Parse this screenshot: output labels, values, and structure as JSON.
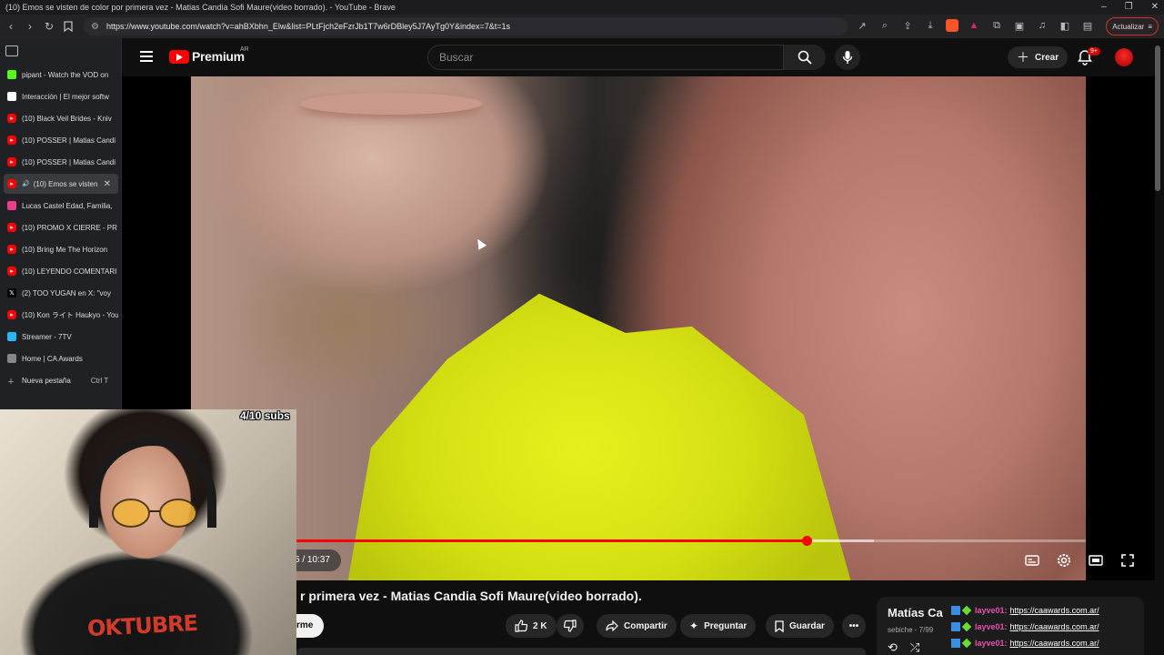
{
  "window": {
    "title": "(10) Emos se visten de color por primera vez - Matias Candia Sofi Maure(video borrado). - YouTube - Brave"
  },
  "browser": {
    "url": "https://www.youtube.com/watch?v=ahBXbhn_Elw&list=PLtFjch2eFzrJb1T7w6rDBley5J7AyTg0Y&index=7&t=1s",
    "update_label": "Actualizar"
  },
  "tabs": [
    {
      "label": "pipant - Watch the VOD on",
      "favicon": "kick-icon",
      "color": "#53fc18"
    },
    {
      "label": "Interacción | El mejor softw",
      "favicon": "diamond-icon",
      "color": "#ffffff"
    },
    {
      "label": "(10) Black Veil Brides - Kniv",
      "favicon": "youtube-icon",
      "color": "#ff0000"
    },
    {
      "label": "(10) POSSER | Matias Candi",
      "favicon": "youtube-icon",
      "color": "#ff0000"
    },
    {
      "label": "(10) POSSER | Matias Candi",
      "favicon": "youtube-icon",
      "color": "#ff0000"
    },
    {
      "label": "(10) Emos se visten",
      "favicon": "youtube-icon",
      "color": "#ff0000",
      "active": true
    },
    {
      "label": "Lucas Castel Edad, Familia,",
      "favicon": "star-icon",
      "color": "#e83e8c"
    },
    {
      "label": "(10) PROMO X CIERRE - PR",
      "favicon": "youtube-icon",
      "color": "#ff0000"
    },
    {
      "label": "(10) Bring Me The Horizon",
      "favicon": "youtube-icon",
      "color": "#ff0000"
    },
    {
      "label": "(10) LEYENDO COMENTARI",
      "favicon": "youtube-icon",
      "color": "#ff0000"
    },
    {
      "label": "(2) TOO YUGAN en X: \"voy",
      "favicon": "x-icon",
      "color": "#000000"
    },
    {
      "label": "(10) Kon ライト Haukyo - YouT",
      "favicon": "youtube-icon",
      "color": "#ff0000"
    },
    {
      "label": "Streamer - 7TV",
      "favicon": "7tv-icon",
      "color": "#29b6f6"
    },
    {
      "label": "Home | CA Awards",
      "favicon": "globe-icon",
      "color": "#888888"
    }
  ],
  "new_tab": {
    "label": "Nueva pestaña",
    "shortcut": "Ctrl T"
  },
  "youtube": {
    "logo_text": "Premium",
    "country": "AR",
    "search_placeholder": "Buscar",
    "create_label": "Crear",
    "notifications_badge": "9+",
    "time_display": "5 / 10:37",
    "progress_fraction": 0.71,
    "buffered_fraction": 0.78,
    "video_title": "r primera vez - Matias Candia Sofi Maure(video borrado).",
    "subscribe_fragment": "rme",
    "likes": "2 K",
    "share_label": "Compartir",
    "ask_label": "Preguntar",
    "save_label": "Guardar"
  },
  "playlist": {
    "title": "Matías Ca",
    "subtitle": "sebiche - 7/99"
  },
  "webcam": {
    "subs_counter": "4/10 subs",
    "shirt_text": "OKTUBRE"
  },
  "chat": [
    {
      "user": "layve01:",
      "message": "https://caawards.com.ar/"
    },
    {
      "user": "layve01:",
      "message": "https://caawards.com.ar/"
    },
    {
      "user": "layve01:",
      "message": "https://caawards.com.ar/"
    }
  ],
  "colors": {
    "accent": "#ff0000",
    "background": "#0f0f0f",
    "chat_user": "#e64fb4"
  }
}
